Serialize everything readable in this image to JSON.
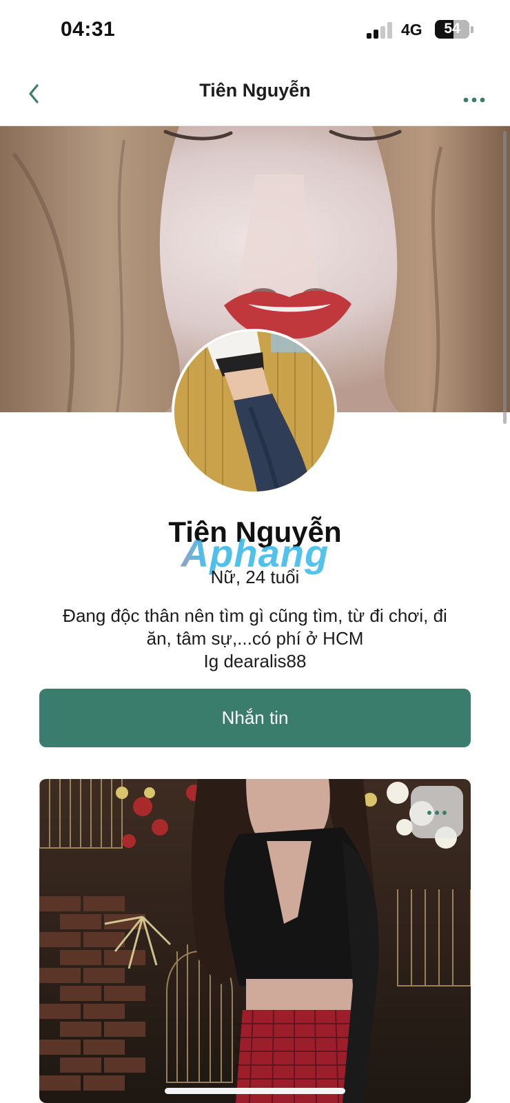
{
  "status_bar": {
    "time": "04:31",
    "network": "4G",
    "battery": "54",
    "battery_level": 0.54
  },
  "nav": {
    "title": "Tiên Nguyễn",
    "accent_color": "#3a7d6c"
  },
  "icons": {
    "back": "chevron-left-icon",
    "more": "ellipsis-icon",
    "photo_more": "ellipsis-icon"
  },
  "profile": {
    "name": "Tiên Nguyễn",
    "watermark": "Aphang",
    "meta": "Nữ, 24 tuổi",
    "bio_line1": "Đang độc thân nên tìm gì cũng tìm, từ đi chơi, đi",
    "bio_line2": "ăn, tâm sự,...có phí ở HCM",
    "bio_line3": "Ig dearalis88"
  },
  "actions": {
    "message_label": "Nhắn tin",
    "button_color": "#3a7d6c"
  }
}
